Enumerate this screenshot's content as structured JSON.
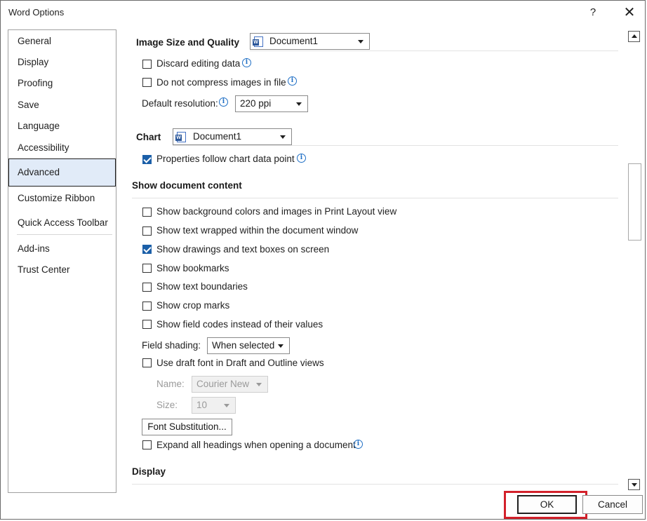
{
  "window": {
    "title": "Word Options",
    "help": "?",
    "close": "✕"
  },
  "sidebar": {
    "items": [
      {
        "label": "General"
      },
      {
        "label": "Display"
      },
      {
        "label": "Proofing"
      },
      {
        "label": "Save"
      },
      {
        "label": "Language"
      },
      {
        "label": "Accessibility"
      },
      {
        "label": "Advanced",
        "selected": true
      },
      {
        "label": "Customize Ribbon"
      },
      {
        "label": "Quick Access Toolbar"
      },
      {
        "label": "Add-ins"
      },
      {
        "label": "Trust Center"
      }
    ]
  },
  "image_size": {
    "title": "Image Size and Quality",
    "document": "Document1",
    "discard_editing": {
      "label": "Discard editing data",
      "checked": false
    },
    "no_compress": {
      "label": "Do not compress images in file",
      "checked": false
    },
    "resolution_label": "Default resolution:",
    "resolution_value": "220 ppi"
  },
  "chart": {
    "title": "Chart",
    "document": "Document1",
    "follow_data_point": {
      "label": "Properties follow chart data point",
      "checked": true
    }
  },
  "show_content": {
    "title": "Show document content",
    "options": [
      {
        "label": "Show background colors and images in Print Layout view",
        "checked": false
      },
      {
        "label": "Show text wrapped within the document window",
        "checked": false
      },
      {
        "label": "Show drawings and text boxes on screen",
        "checked": true
      },
      {
        "label": "Show bookmarks",
        "checked": false
      },
      {
        "label": "Show text boundaries",
        "checked": false
      },
      {
        "label": "Show crop marks",
        "checked": false
      },
      {
        "label": "Show field codes instead of their values",
        "checked": false
      }
    ],
    "field_shading_label": "Field shading:",
    "field_shading_value": "When selected",
    "draft_font": {
      "label": "Use draft font in Draft and Outline views",
      "checked": false
    },
    "name_label": "Name:",
    "name_value": "Courier New",
    "size_label": "Size:",
    "size_value": "10",
    "font_substitution": "Font Substitution...",
    "expand_headings": {
      "label": "Expand all headings when opening a document",
      "checked": false
    }
  },
  "display_section": {
    "title": "Display"
  },
  "footer": {
    "ok": "OK",
    "cancel": "Cancel"
  },
  "colors": {
    "accent": "#1b5fa8",
    "highlight_box": "#d3212b",
    "selected_nav": "#e1ebf8"
  }
}
